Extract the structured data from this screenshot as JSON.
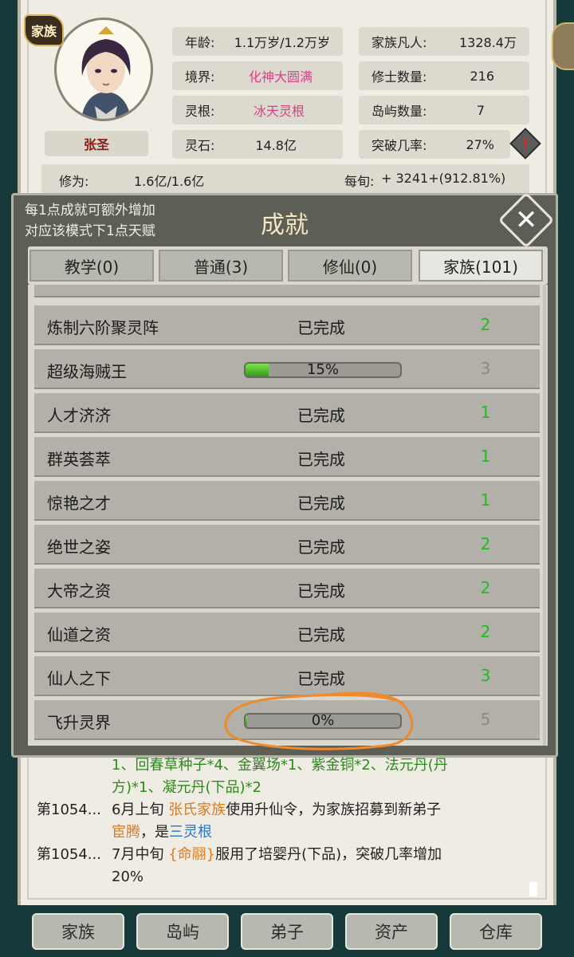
{
  "header": {
    "badge": "家族",
    "name": "张圣",
    "stats": {
      "age": {
        "label": "年龄:",
        "value": "1.1万岁/1.2万岁"
      },
      "realm": {
        "label": "境界:",
        "value": "化神大圆满"
      },
      "root": {
        "label": "灵根:",
        "value": "冰天灵根"
      },
      "stones": {
        "label": "灵石:",
        "value": "14.8亿"
      },
      "mortals": {
        "label": "家族凡人:",
        "value": "1328.4万"
      },
      "cultivators": {
        "label": "修士数量:",
        "value": "216"
      },
      "islands": {
        "label": "岛屿数量:",
        "value": "7"
      },
      "breakthrough": {
        "label": "突破几率:",
        "value": "27%"
      }
    },
    "cultivation": {
      "label": "修为:",
      "value": "1.6亿/1.6亿",
      "rate_label": "每旬:",
      "rate_value": "+ 3241+(912.81%)"
    },
    "accent": "#e03c8c"
  },
  "dialog": {
    "hint_line1": "每1点成就可额外增加",
    "hint_line2": "对应该模式下1点天赋",
    "title": "成就",
    "close": "✕",
    "tabs": [
      {
        "label": "教学(0)"
      },
      {
        "label": "普通(3)"
      },
      {
        "label": "修仙(0)"
      },
      {
        "label": "家族(101)"
      }
    ],
    "rows": [
      {
        "name": "炼制六阶聚灵阵",
        "status": "已完成",
        "points": "2",
        "done": true
      },
      {
        "name": "超级海贼王",
        "status": "15%",
        "points": "3",
        "done": false,
        "progress": 0.15
      },
      {
        "name": "人才济济",
        "status": "已完成",
        "points": "1",
        "done": true
      },
      {
        "name": "群英荟萃",
        "status": "已完成",
        "points": "1",
        "done": true
      },
      {
        "name": "惊艳之才",
        "status": "已完成",
        "points": "1",
        "done": true
      },
      {
        "name": "绝世之姿",
        "status": "已完成",
        "points": "2",
        "done": true
      },
      {
        "name": "大帝之资",
        "status": "已完成",
        "points": "2",
        "done": true
      },
      {
        "name": "仙道之资",
        "status": "已完成",
        "points": "2",
        "done": true
      },
      {
        "name": "仙人之下",
        "status": "已完成",
        "points": "3",
        "done": true
      },
      {
        "name": "飞升灵界",
        "status": "0%",
        "points": "5",
        "done": false,
        "progress": 0.0
      }
    ],
    "done_color": "#1fbd1f"
  },
  "log": {
    "line0a": "1、回春草种子*4、金翼场*1、紫金铜*2、法元丹(丹",
    "line0b": "方)*1、凝元丹(下品)*2",
    "e1_prefix": "第1054...",
    "e1_a": "6月上旬 ",
    "e1_clan": "张氏家族",
    "e1_b": "使用升仙令，为家族招募到新弟子",
    "e1_person": "宦腾",
    "e1_c": "，是",
    "e1_root": "三灵根",
    "e2_prefix": "第1054...",
    "e2_a": "7月中旬 ",
    "e2_person": "{命翮}",
    "e2_b": "服用了培婴丹(下品)，突破几率增加",
    "e2_c": "20%"
  },
  "nav": [
    {
      "label": "家族"
    },
    {
      "label": "岛屿"
    },
    {
      "label": "弟子"
    },
    {
      "label": "资产"
    },
    {
      "label": "仓库"
    }
  ]
}
